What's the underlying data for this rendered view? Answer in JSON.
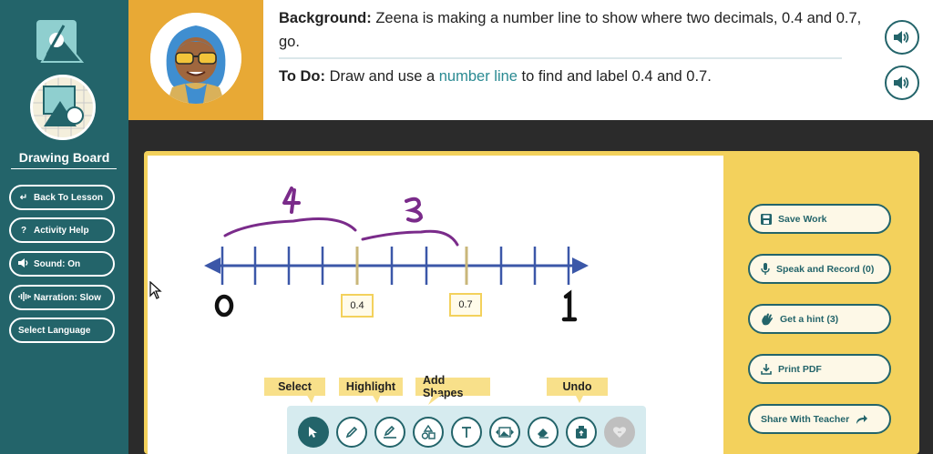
{
  "sidebar": {
    "title": "Drawing Board",
    "buttons": [
      {
        "label": "Back To Lesson",
        "icon": "back-arrow-icon",
        "glyph": "↵"
      },
      {
        "label": "Activity Help",
        "icon": "question-icon",
        "glyph": "?"
      },
      {
        "label": "Sound: On",
        "icon": "speaker-icon",
        "glyph": "◀)"
      },
      {
        "label": "Narration: Slow",
        "icon": "waveform-icon",
        "glyph": "≋"
      },
      {
        "label": "Select Language",
        "icon": "",
        "glyph": ""
      }
    ]
  },
  "header": {
    "background_label": "Background:",
    "background_text": " Zeena is making a number line to show where two decimals, 0.4 and 0.7, go.",
    "todo_label": "To Do:",
    "todo_pre": " Draw and use a ",
    "todo_link": "number line",
    "todo_post": " to find and label 0.4 and 0.7."
  },
  "canvas": {
    "labels": [
      "0.4",
      "0.7"
    ],
    "handwritten": [
      "4",
      "3",
      "0",
      "1"
    ]
  },
  "right_panel": {
    "buttons": [
      {
        "label": "Save Work",
        "icon": "save-icon"
      },
      {
        "label": "Speak and Record (0)",
        "icon": "microphone-icon"
      },
      {
        "label": "Get a hint (3)",
        "icon": "hand-wave-icon"
      },
      {
        "label": "Print PDF",
        "icon": "download-icon"
      },
      {
        "label": "Share With Teacher",
        "icon": "share-arrow-icon"
      }
    ]
  },
  "toolbar": {
    "tooltips": [
      "Select",
      "Highlight",
      "Add Shapes",
      "Undo"
    ],
    "tools": [
      "select-tool",
      "pencil-tool",
      "highlight-tool",
      "shapes-tool",
      "text-tool",
      "image-tool",
      "eraser-tool",
      "undo-tool",
      "favorite-tool"
    ]
  },
  "colors": {
    "teal": "#23646a",
    "gold": "#e8a935",
    "yellow": "#f3d15c",
    "number_line": "#3b57a8",
    "handwriting": "#7a2b8a"
  }
}
